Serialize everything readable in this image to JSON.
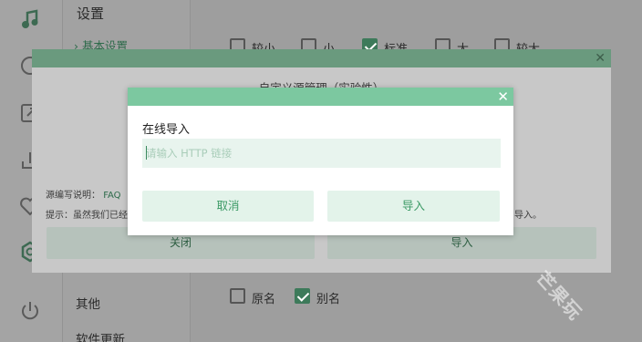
{
  "app": {
    "title": "设置",
    "rail_icons": [
      "music-note-icon",
      "clock-icon",
      "share-icon",
      "download-icon",
      "heart-icon",
      "settings-icon",
      "power-icon"
    ]
  },
  "nav": {
    "items": [
      {
        "label": "基本设置"
      },
      {
        "label": "其他"
      },
      {
        "label": "软件更新"
      }
    ]
  },
  "settings": {
    "size_options": [
      {
        "label": "较小",
        "checked": false
      },
      {
        "label": "小",
        "checked": false
      },
      {
        "label": "标准",
        "checked": true
      },
      {
        "label": "大",
        "checked": false
      },
      {
        "label": "较大",
        "checked": false
      }
    ],
    "name_options": [
      {
        "label": "原名",
        "checked": false
      },
      {
        "label": "别名",
        "checked": true
      }
    ]
  },
  "source_dialog": {
    "title": "自定义源管理（实验性）",
    "help_text": "源编写说明：",
    "help_link": "FAQ",
    "tip_text": "提示：虽然我们已经",
    "tip_tail": "导入。",
    "close_label": "关闭",
    "import_label": "导入",
    "close_glyph": "✕"
  },
  "import_dialog": {
    "label": "在线导入",
    "url_placeholder": "请输入 HTTP 链接",
    "url_value": "",
    "cancel_label": "取消",
    "import_label": "导入",
    "close_glyph": "✕"
  },
  "watermark": "芒果玩",
  "colors": {
    "accent": "#7cc8a0",
    "accent_text": "#3c9a66",
    "accent_light": "#e3f3ea"
  }
}
